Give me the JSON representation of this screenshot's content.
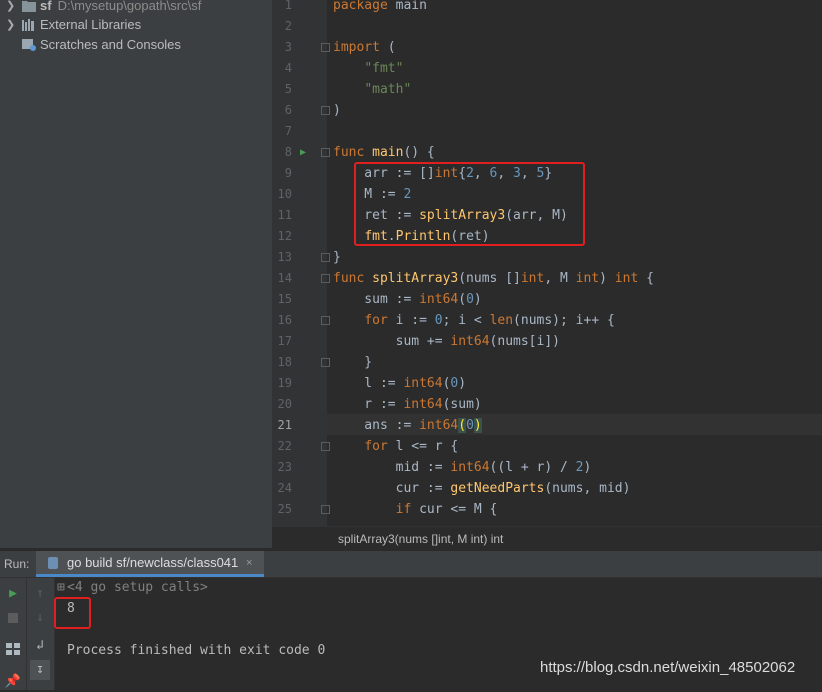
{
  "project_tree": {
    "items": [
      {
        "label": "sf",
        "path": "D:\\mysetup\\gopath\\src\\sf"
      },
      {
        "label": "External Libraries"
      },
      {
        "label": "Scratches and Consoles"
      }
    ]
  },
  "editor": {
    "line_numbers": [
      "1",
      "2",
      "3",
      "4",
      "5",
      "6",
      "7",
      "8",
      "9",
      "10",
      "11",
      "12",
      "13",
      "14",
      "15",
      "16",
      "17",
      "18",
      "19",
      "20",
      "21",
      "22",
      "23",
      "24",
      "25"
    ],
    "current_line": 21
  },
  "breadcrumb": "splitArray3(nums []int, M int) int",
  "run_panel": {
    "label": "Run:",
    "tab_label": "go build sf/newclass/class041",
    "close_glyph": "×",
    "console": {
      "setup_calls": "<4 go setup calls>",
      "output": "8",
      "finish": "Process finished with exit code 0"
    }
  },
  "watermark": "https://blog.csdn.net/weixin_48502062",
  "colors": {
    "highlight_box": "#e02020",
    "keyword": "#cc7832",
    "function": "#ffc66d",
    "string": "#6a8759",
    "number": "#6897bb"
  }
}
